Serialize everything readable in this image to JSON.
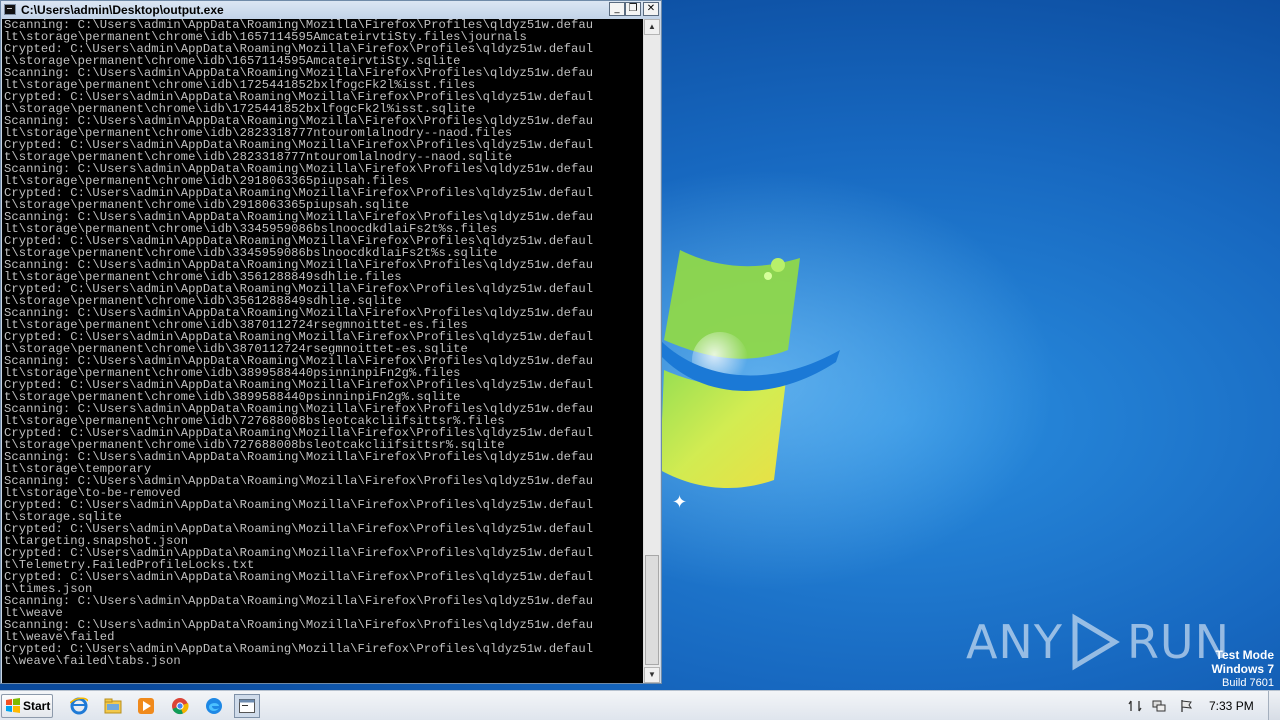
{
  "window": {
    "title": "C:\\Users\\admin\\Desktop\\output.exe",
    "minimize_glyph": "_",
    "maximize_glyph": "❐",
    "close_glyph": "✕"
  },
  "console": {
    "lines": [
      "Scanning: C:\\Users\\admin\\AppData\\Roaming\\Mozilla\\Firefox\\Profiles\\qldyz51w.defau",
      "lt\\storage\\permanent\\chrome\\idb\\1657114595AmcateirvtiSty.files\\journals",
      "Crypted: C:\\Users\\admin\\AppData\\Roaming\\Mozilla\\Firefox\\Profiles\\qldyz51w.defaul",
      "t\\storage\\permanent\\chrome\\idb\\1657114595AmcateirvtiSty.sqlite",
      "Scanning: C:\\Users\\admin\\AppData\\Roaming\\Mozilla\\Firefox\\Profiles\\qldyz51w.defau",
      "lt\\storage\\permanent\\chrome\\idb\\1725441852bxlfogcFk2l%isst.files",
      "Crypted: C:\\Users\\admin\\AppData\\Roaming\\Mozilla\\Firefox\\Profiles\\qldyz51w.defaul",
      "t\\storage\\permanent\\chrome\\idb\\1725441852bxlfogcFk2l%isst.sqlite",
      "Scanning: C:\\Users\\admin\\AppData\\Roaming\\Mozilla\\Firefox\\Profiles\\qldyz51w.defau",
      "lt\\storage\\permanent\\chrome\\idb\\2823318777ntouromlalnodry--naod.files",
      "Crypted: C:\\Users\\admin\\AppData\\Roaming\\Mozilla\\Firefox\\Profiles\\qldyz51w.defaul",
      "t\\storage\\permanent\\chrome\\idb\\2823318777ntouromlalnodry--naod.sqlite",
      "Scanning: C:\\Users\\admin\\AppData\\Roaming\\Mozilla\\Firefox\\Profiles\\qldyz51w.defau",
      "lt\\storage\\permanent\\chrome\\idb\\2918063365piupsah.files",
      "Crypted: C:\\Users\\admin\\AppData\\Roaming\\Mozilla\\Firefox\\Profiles\\qldyz51w.defaul",
      "t\\storage\\permanent\\chrome\\idb\\2918063365piupsah.sqlite",
      "Scanning: C:\\Users\\admin\\AppData\\Roaming\\Mozilla\\Firefox\\Profiles\\qldyz51w.defau",
      "lt\\storage\\permanent\\chrome\\idb\\3345959086bslnoocdkdlaiFs2t%s.files",
      "Crypted: C:\\Users\\admin\\AppData\\Roaming\\Mozilla\\Firefox\\Profiles\\qldyz51w.defaul",
      "t\\storage\\permanent\\chrome\\idb\\3345959086bslnoocdkdlaiFs2t%s.sqlite",
      "Scanning: C:\\Users\\admin\\AppData\\Roaming\\Mozilla\\Firefox\\Profiles\\qldyz51w.defau",
      "lt\\storage\\permanent\\chrome\\idb\\3561288849sdhlie.files",
      "Crypted: C:\\Users\\admin\\AppData\\Roaming\\Mozilla\\Firefox\\Profiles\\qldyz51w.defaul",
      "t\\storage\\permanent\\chrome\\idb\\3561288849sdhlie.sqlite",
      "Scanning: C:\\Users\\admin\\AppData\\Roaming\\Mozilla\\Firefox\\Profiles\\qldyz51w.defau",
      "lt\\storage\\permanent\\chrome\\idb\\3870112724rsegmnoittet-es.files",
      "Crypted: C:\\Users\\admin\\AppData\\Roaming\\Mozilla\\Firefox\\Profiles\\qldyz51w.defaul",
      "t\\storage\\permanent\\chrome\\idb\\3870112724rsegmnoittet-es.sqlite",
      "Scanning: C:\\Users\\admin\\AppData\\Roaming\\Mozilla\\Firefox\\Profiles\\qldyz51w.defau",
      "lt\\storage\\permanent\\chrome\\idb\\3899588440psinninpiFn2g%.files",
      "Crypted: C:\\Users\\admin\\AppData\\Roaming\\Mozilla\\Firefox\\Profiles\\qldyz51w.defaul",
      "t\\storage\\permanent\\chrome\\idb\\3899588440psinninpiFn2g%.sqlite",
      "Scanning: C:\\Users\\admin\\AppData\\Roaming\\Mozilla\\Firefox\\Profiles\\qldyz51w.defau",
      "lt\\storage\\permanent\\chrome\\idb\\727688008bsleotcakcliifsittsr%.files",
      "Crypted: C:\\Users\\admin\\AppData\\Roaming\\Mozilla\\Firefox\\Profiles\\qldyz51w.defaul",
      "t\\storage\\permanent\\chrome\\idb\\727688008bsleotcakcliifsittsr%.sqlite",
      "Scanning: C:\\Users\\admin\\AppData\\Roaming\\Mozilla\\Firefox\\Profiles\\qldyz51w.defau",
      "lt\\storage\\temporary",
      "Scanning: C:\\Users\\admin\\AppData\\Roaming\\Mozilla\\Firefox\\Profiles\\qldyz51w.defau",
      "lt\\storage\\to-be-removed",
      "Crypted: C:\\Users\\admin\\AppData\\Roaming\\Mozilla\\Firefox\\Profiles\\qldyz51w.defaul",
      "t\\storage.sqlite",
      "Crypted: C:\\Users\\admin\\AppData\\Roaming\\Mozilla\\Firefox\\Profiles\\qldyz51w.defaul",
      "t\\targeting.snapshot.json",
      "Crypted: C:\\Users\\admin\\AppData\\Roaming\\Mozilla\\Firefox\\Profiles\\qldyz51w.defaul",
      "t\\Telemetry.FailedProfileLocks.txt",
      "Crypted: C:\\Users\\admin\\AppData\\Roaming\\Mozilla\\Firefox\\Profiles\\qldyz51w.defaul",
      "t\\times.json",
      "Scanning: C:\\Users\\admin\\AppData\\Roaming\\Mozilla\\Firefox\\Profiles\\qldyz51w.defau",
      "lt\\weave",
      "Scanning: C:\\Users\\admin\\AppData\\Roaming\\Mozilla\\Firefox\\Profiles\\qldyz51w.defau",
      "lt\\weave\\failed",
      "Crypted: C:\\Users\\admin\\AppData\\Roaming\\Mozilla\\Firefox\\Profiles\\qldyz51w.defaul",
      "t\\weave\\failed\\tabs.json"
    ],
    "scroll_position": 0.93
  },
  "watermark": {
    "brand_left": "ANY",
    "brand_right": "RUN"
  },
  "os_info": {
    "line1": "Test Mode",
    "line2": "Windows 7",
    "line3": "Build 7601"
  },
  "taskbar": {
    "start_label": "Start",
    "apps": [
      "ie-icon",
      "explorer-icon",
      "media-player-icon",
      "chrome-icon",
      "edge-icon",
      "console-icon"
    ],
    "clock": "7:33 PM"
  },
  "colors": {
    "console_bg": "#000000",
    "console_text": "#c0c0c0",
    "desktop_blue": "#1768c0"
  }
}
